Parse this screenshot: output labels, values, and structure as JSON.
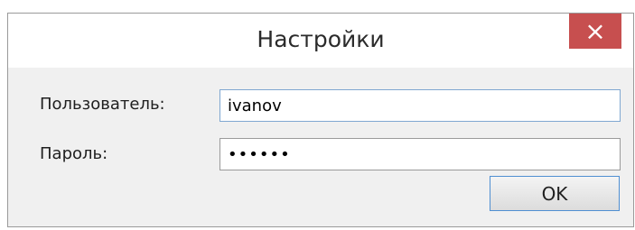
{
  "window": {
    "title": "Настройки",
    "close_glyph": "×"
  },
  "form": {
    "user_label": "Пользователь:",
    "user_value": "ivanov",
    "password_label": "Пароль:",
    "password_value": "••••••"
  },
  "buttons": {
    "ok_label": "OK"
  },
  "icons": {
    "close": "close-icon"
  },
  "colors": {
    "close_background": "#c74f4f",
    "field_focus_border": "#7fa7d1",
    "button_border": "#4f8fd2",
    "dialog_background": "#f0f0f0"
  }
}
